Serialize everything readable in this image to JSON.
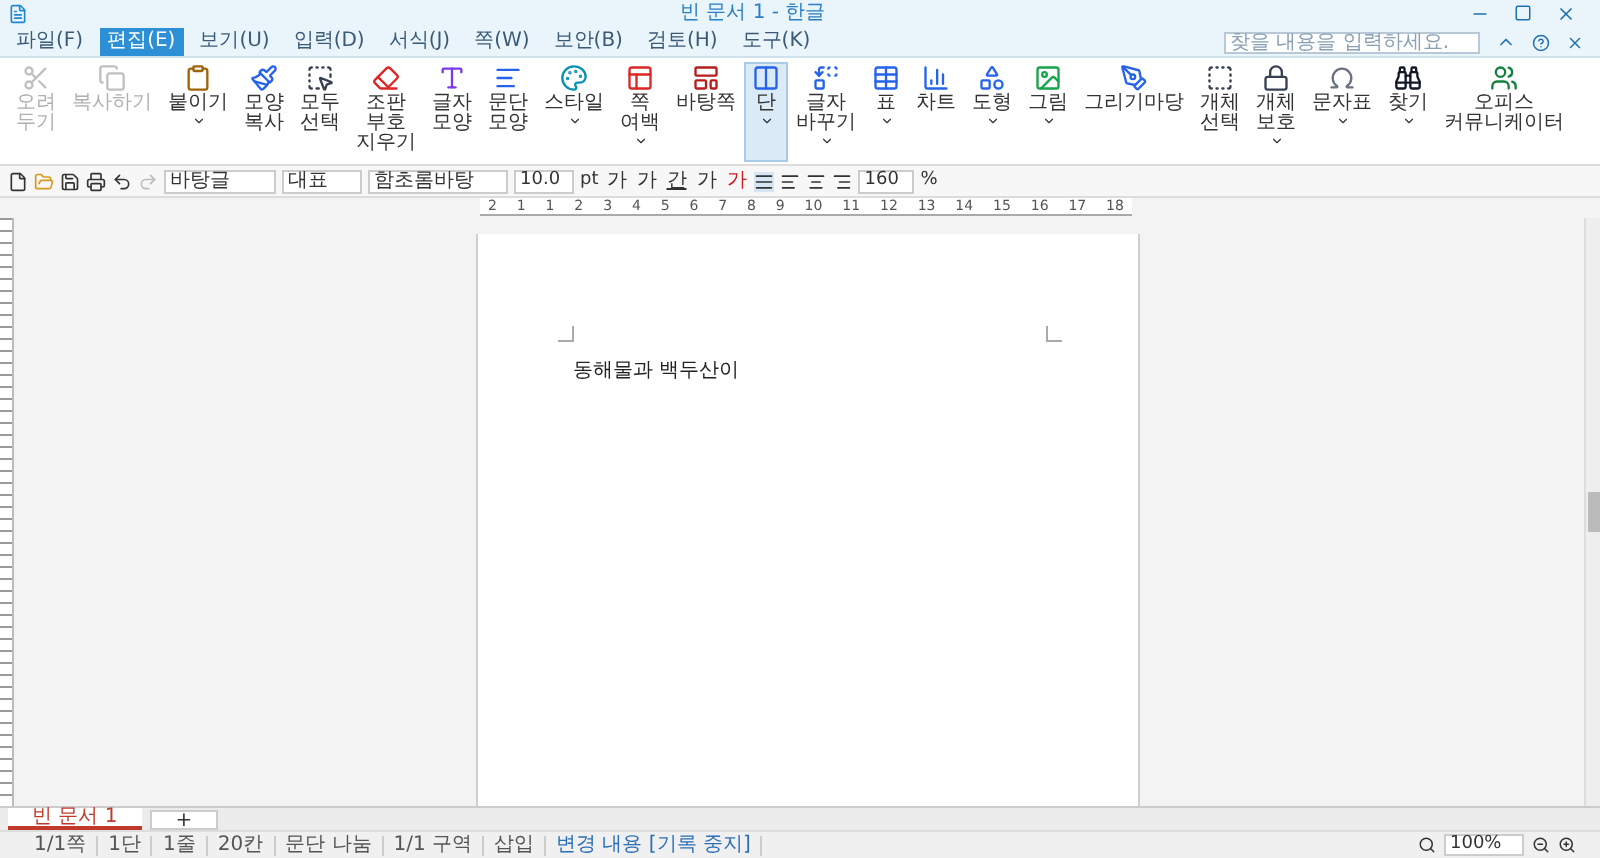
{
  "window": {
    "title": "빈 문서 1 - 한글"
  },
  "menu": [
    {
      "label": "파일(F)",
      "selected": false
    },
    {
      "label": "편집(E)",
      "selected": true
    },
    {
      "label": "보기(U)",
      "selected": false
    },
    {
      "label": "입력(D)",
      "selected": false
    },
    {
      "label": "서식(J)",
      "selected": false
    },
    {
      "label": "쪽(W)",
      "selected": false
    },
    {
      "label": "보안(B)",
      "selected": false
    },
    {
      "label": "검토(H)",
      "selected": false
    },
    {
      "label": "도구(K)",
      "selected": false
    }
  ],
  "search": {
    "placeholder": "찾을 내용을 입력하세요."
  },
  "ribbon": [
    {
      "label": "오려 두기",
      "disabled": true,
      "selected": false,
      "menu": false
    },
    {
      "label": "복사하기",
      "disabled": true,
      "selected": false,
      "menu": false
    },
    {
      "label": "붙이기",
      "disabled": false,
      "selected": false,
      "menu": true
    },
    {
      "label": "모양 복사",
      "disabled": false,
      "selected": false,
      "menu": false
    },
    {
      "label": "모두 선택",
      "disabled": false,
      "selected": false,
      "menu": false
    },
    {
      "label": "조판 부호 지우기",
      "disabled": false,
      "selected": false,
      "menu": false
    },
    {
      "label": "글자 모양",
      "disabled": false,
      "selected": false,
      "menu": false
    },
    {
      "label": "문단 모양",
      "disabled": false,
      "selected": false,
      "menu": false
    },
    {
      "label": "스타일",
      "disabled": false,
      "selected": false,
      "menu": true
    },
    {
      "label": "쪽 여백",
      "disabled": false,
      "selected": false,
      "menu": true
    },
    {
      "label": "바탕쪽",
      "disabled": false,
      "selected": false,
      "menu": false
    },
    {
      "label": "단",
      "disabled": false,
      "selected": true,
      "menu": true
    },
    {
      "label": "글자 바꾸기",
      "disabled": false,
      "selected": false,
      "menu": true
    },
    {
      "label": "표",
      "disabled": false,
      "selected": false,
      "menu": true
    },
    {
      "label": "차트",
      "disabled": false,
      "selected": false,
      "menu": false
    },
    {
      "label": "도형",
      "disabled": false,
      "selected": false,
      "menu": true
    },
    {
      "label": "그림",
      "disabled": false,
      "selected": false,
      "menu": true
    },
    {
      "label": "그리기마당",
      "disabled": false,
      "selected": false,
      "menu": false
    },
    {
      "label": "개체 선택",
      "disabled": false,
      "selected": false,
      "menu": false
    },
    {
      "label": "개체 보호",
      "disabled": false,
      "selected": false,
      "menu": true
    },
    {
      "label": "문자표",
      "disabled": false,
      "selected": false,
      "menu": true
    },
    {
      "label": "찾기",
      "disabled": false,
      "selected": false,
      "menu": true
    },
    {
      "label": "오피스 커뮤니케이터",
      "disabled": false,
      "selected": false,
      "menu": false
    }
  ],
  "toolbar": {
    "style": "바탕글",
    "language": "대표",
    "font": "함초롬바탕",
    "size": "10.0",
    "unit": "pt",
    "format": [
      "가",
      "가",
      "간",
      "가",
      "가"
    ],
    "line_spacing": "160",
    "spacing_unit": "%"
  },
  "ruler": [
    "2",
    "1",
    "1",
    "2",
    "3",
    "4",
    "5",
    "6",
    "7",
    "8",
    "9",
    "10",
    "11",
    "12",
    "13",
    "14",
    "15",
    "16",
    "17",
    "18"
  ],
  "document": {
    "text": "동해물과 백두산이"
  },
  "tabs": [
    {
      "label": "빈 문서 1",
      "selected": true
    }
  ],
  "add_tab": "+",
  "status_bar": [
    {
      "text": "1/1쪽",
      "kind": "plain"
    },
    {
      "text": "1단",
      "kind": "plain"
    },
    {
      "text": "1줄",
      "kind": "plain"
    },
    {
      "text": "20칸",
      "kind": "plain"
    },
    {
      "text": "문단 나눔",
      "kind": "plain"
    },
    {
      "text": "1/1 구역",
      "kind": "plain"
    },
    {
      "text": "삽입",
      "kind": "plain"
    },
    {
      "text": "변경 내용 [기록 중지]",
      "kind": "link"
    }
  ],
  "zoom": "100%"
}
